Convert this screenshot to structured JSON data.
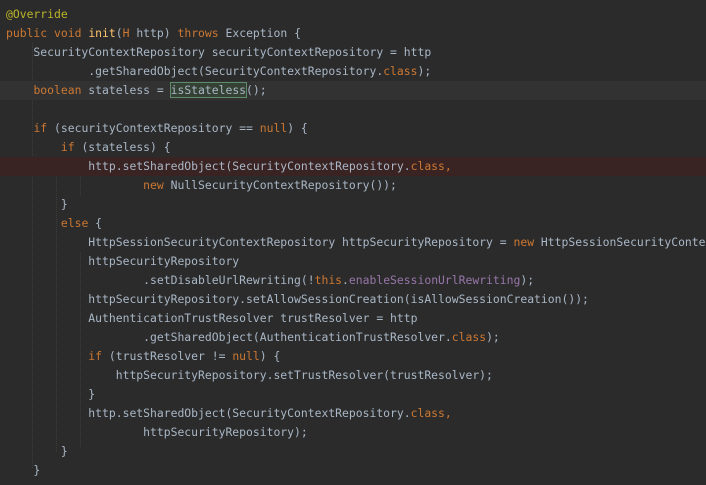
{
  "editor": {
    "colors": {
      "background": "#2b2b2b",
      "keyword": "#cc7832",
      "annotation": "#bbb529",
      "method_declaration": "#ffc66d",
      "field": "#9876aa",
      "default_text": "#a9b7c6",
      "caret_line": "#323232",
      "breakpoint_line": "#3a2323"
    },
    "lines": [
      {
        "tokens": [
          {
            "t": "@Override",
            "k": "anno"
          }
        ]
      },
      {
        "tokens": [
          {
            "t": "public",
            "k": "kw"
          },
          {
            "t": " ",
            "k": "id"
          },
          {
            "t": "void",
            "k": "kw"
          },
          {
            "t": " ",
            "k": "id"
          },
          {
            "t": "init",
            "k": "fn"
          },
          {
            "t": "(",
            "k": "id"
          },
          {
            "t": "H",
            "k": "kw"
          },
          {
            "t": " http) ",
            "k": "id"
          },
          {
            "t": "throws",
            "k": "kw"
          },
          {
            "t": " Exception {",
            "k": "id"
          }
        ]
      },
      {
        "tokens": [
          {
            "t": "    SecurityContextRepository securityContextRepository = http",
            "k": "id"
          }
        ]
      },
      {
        "tokens": [
          {
            "t": "            .getSharedObject(SecurityContextRepository.",
            "k": "id"
          },
          {
            "t": "class",
            "k": "kw"
          },
          {
            "t": ");",
            "k": "id"
          }
        ]
      },
      {
        "tokens": [
          {
            "t": "    ",
            "k": "id"
          },
          {
            "t": "boolean",
            "k": "kw"
          },
          {
            "t": " stateless = ",
            "k": "id"
          },
          {
            "t": "isStateless",
            "k": "hl"
          },
          {
            "t": "();",
            "k": "id"
          }
        ],
        "caret": true
      },
      {
        "tokens": []
      },
      {
        "tokens": [
          {
            "t": "    ",
            "k": "id"
          },
          {
            "t": "if",
            "k": "kw"
          },
          {
            "t": " (securityContextRepository == ",
            "k": "id"
          },
          {
            "t": "null",
            "k": "kw"
          },
          {
            "t": ") {",
            "k": "id"
          }
        ]
      },
      {
        "tokens": [
          {
            "t": "        ",
            "k": "id"
          },
          {
            "t": "if",
            "k": "kw"
          },
          {
            "t": " (stateless) {",
            "k": "id"
          }
        ]
      },
      {
        "tokens": [
          {
            "t": "            http.setSharedObject(SecurityContextRepository.",
            "k": "id"
          },
          {
            "t": "class",
            "k": "kw"
          },
          {
            "t": ",",
            "k": "kw"
          }
        ],
        "breakpoint": true
      },
      {
        "tokens": [
          {
            "t": "                    ",
            "k": "id"
          },
          {
            "t": "new",
            "k": "kw"
          },
          {
            "t": " NullSecurityContextRepository());",
            "k": "id"
          }
        ]
      },
      {
        "tokens": [
          {
            "t": "        }",
            "k": "id"
          }
        ]
      },
      {
        "tokens": [
          {
            "t": "        ",
            "k": "id"
          },
          {
            "t": "else",
            "k": "kw"
          },
          {
            "t": " {",
            "k": "id"
          }
        ]
      },
      {
        "tokens": [
          {
            "t": "            HttpSessionSecurityContextRepository httpSecurityRepository = ",
            "k": "id"
          },
          {
            "t": "new",
            "k": "kw"
          },
          {
            "t": " HttpSessionSecurityContextRepository();",
            "k": "id"
          }
        ]
      },
      {
        "tokens": [
          {
            "t": "            httpSecurityRepository",
            "k": "id"
          }
        ]
      },
      {
        "tokens": [
          {
            "t": "                    .setDisableUrlRewriting(!",
            "k": "id"
          },
          {
            "t": "this",
            "k": "kw"
          },
          {
            "t": ".",
            "k": "id"
          },
          {
            "t": "enableSessionUrlRewriting",
            "k": "field"
          },
          {
            "t": ");",
            "k": "id"
          }
        ]
      },
      {
        "tokens": [
          {
            "t": "            httpSecurityRepository.setAllowSessionCreation(isAllowSessionCreation());",
            "k": "id"
          }
        ]
      },
      {
        "tokens": [
          {
            "t": "            AuthenticationTrustResolver trustResolver = http",
            "k": "id"
          }
        ]
      },
      {
        "tokens": [
          {
            "t": "                    .getSharedObject(AuthenticationTrustResolver.",
            "k": "id"
          },
          {
            "t": "class",
            "k": "kw"
          },
          {
            "t": ");",
            "k": "id"
          }
        ]
      },
      {
        "tokens": [
          {
            "t": "            ",
            "k": "id"
          },
          {
            "t": "if",
            "k": "kw"
          },
          {
            "t": " (trustResolver != ",
            "k": "id"
          },
          {
            "t": "null",
            "k": "kw"
          },
          {
            "t": ") {",
            "k": "id"
          }
        ]
      },
      {
        "tokens": [
          {
            "t": "                httpSecurityRepository.setTrustResolver(trustResolver);",
            "k": "id"
          }
        ]
      },
      {
        "tokens": [
          {
            "t": "            }",
            "k": "id"
          }
        ]
      },
      {
        "tokens": [
          {
            "t": "            http.setSharedObject(SecurityContextRepository.",
            "k": "id"
          },
          {
            "t": "class",
            "k": "kw"
          },
          {
            "t": ",",
            "k": "kw"
          }
        ]
      },
      {
        "tokens": [
          {
            "t": "                    httpSecurityRepository);",
            "k": "id"
          }
        ]
      },
      {
        "tokens": [
          {
            "t": "        }",
            "k": "id"
          }
        ]
      },
      {
        "tokens": [
          {
            "t": "    }",
            "k": "id"
          }
        ]
      },
      {
        "tokens": []
      }
    ]
  }
}
